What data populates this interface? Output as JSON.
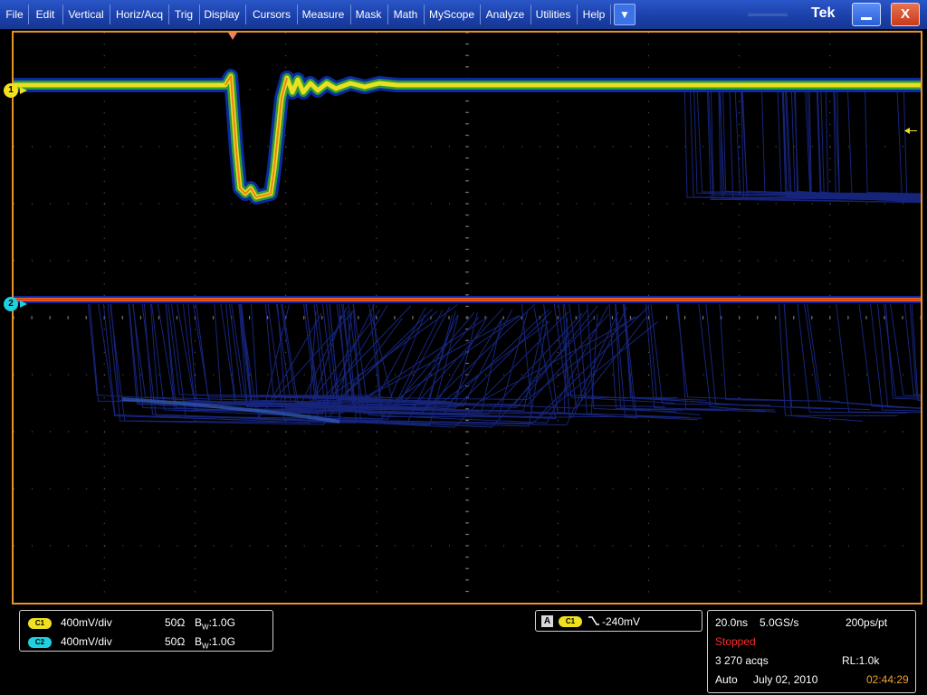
{
  "menu": {
    "items": [
      "File",
      "Edit",
      "Vertical",
      "Horiz/Acq",
      "Trig",
      "Display",
      "Cursors",
      "Measure",
      "Mask",
      "Math",
      "MyScope",
      "Analyze",
      "Utilities",
      "Help"
    ],
    "dropdown_icon": "chevron-down-icon"
  },
  "brand": {
    "name": "Tek"
  },
  "window_controls": {
    "close_label": "X"
  },
  "channels": [
    {
      "id": "1",
      "badge": "C1",
      "scale": "400mV/div",
      "impedance": "50Ω",
      "bw_prefix": "B",
      "bw_sub": "W",
      "bw_value": ":1.0G",
      "color": "#f0e020"
    },
    {
      "id": "2",
      "badge": "C2",
      "scale": "400mV/div",
      "impedance": "50Ω",
      "bw_prefix": "B",
      "bw_sub": "W",
      "bw_value": ":1.0G",
      "color": "#20d0e0"
    }
  ],
  "trigger": {
    "mode": "A",
    "source": "C1",
    "slope_icon": "falling-edge-icon",
    "level": "-240mV"
  },
  "acquisition": {
    "timebase": "20.0ns",
    "sample_rate": "5.0GS/s",
    "resolution": "200ps/pt",
    "status": "Stopped",
    "acqs": "3 270 acqs",
    "record_length": "RL:1.0k",
    "trigger_mode": "Auto",
    "date": "July 02, 2010",
    "time": "02:44:29"
  },
  "colors": {
    "accent_orange": "#e8922a",
    "status_red": "#ff2a2a",
    "time_orange": "#f0a030",
    "menu_blue": "#1a3fa8",
    "ch1_yellow": "#f0e020",
    "ch2_cyan": "#20d0e0"
  }
}
